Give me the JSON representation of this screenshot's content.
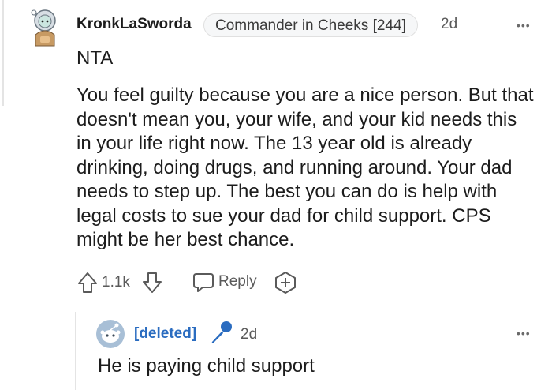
{
  "comment": {
    "author": "KronkLaSworda",
    "flair": "Commander in Cheeks [244]",
    "time": "2d",
    "more_label": "•••",
    "verdict": "NTA",
    "body": "You feel guilty because you are a nice person. But that doesn't mean you, your wife, and your kid needs this in your life right now. The 13 year old is already drinking, doing drugs, and running around. Your dad needs to step up. The best you can do is help with legal costs to sue your dad for child support. CPS might be her best chance.",
    "score": "1.1k",
    "reply_label": "Reply",
    "icons": [
      "avatar-icon",
      "upvote-icon",
      "downvote-icon",
      "reply-icon",
      "award-icon"
    ]
  },
  "reply": {
    "author": "[deleted]",
    "time": "2d",
    "more_label": "•••",
    "body": "He is paying child support",
    "icons": [
      "deleted-avatar-icon",
      "microphone-icon"
    ]
  },
  "colors": {
    "text": "#1c1c1c",
    "meta": "#5a5a5a",
    "deleted_author": "#2a6cc0",
    "mic": "#2a6cc0"
  }
}
